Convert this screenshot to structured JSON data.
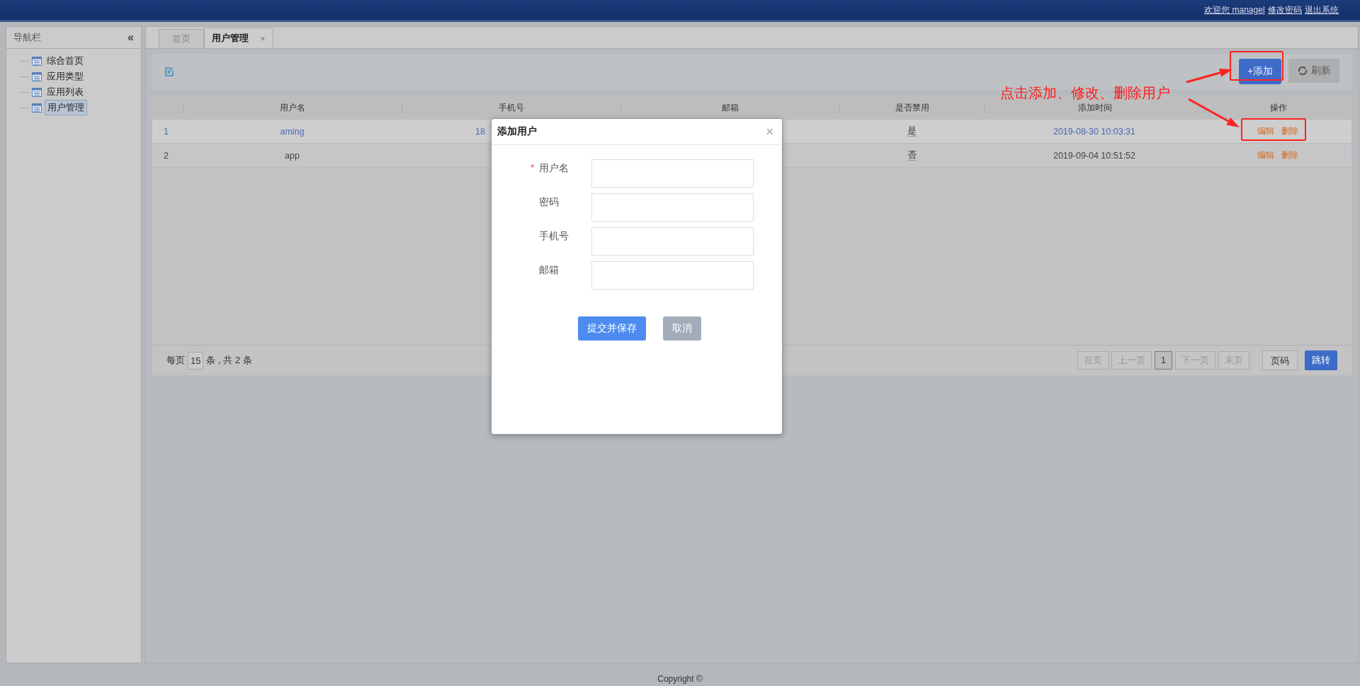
{
  "header": {
    "links": [
      {
        "text": "欢迎您 manage|"
      },
      {
        "text": "修改密码"
      },
      {
        "text": "退出系统"
      }
    ]
  },
  "sidebar": {
    "title": "导航栏",
    "collapse": "«",
    "items": [
      {
        "label": "综合首页",
        "selected": false
      },
      {
        "label": "应用类型",
        "selected": false
      },
      {
        "label": "应用列表",
        "selected": false
      },
      {
        "label": "用户管理",
        "selected": true
      }
    ]
  },
  "tabs": [
    {
      "label": "首页",
      "selected": false
    },
    {
      "label": "用户管理",
      "selected": true,
      "close": "×"
    }
  ],
  "toolbar": {
    "add": "+添加",
    "refresh": "刷新"
  },
  "table": {
    "columns": [
      "用户名",
      "手机号",
      "邮箱",
      "是否禁用",
      "添加时间",
      "操作"
    ],
    "rows": [
      {
        "index": "1",
        "username": "aming",
        "phone": "18",
        "disabled": "是",
        "added": "2019-08-30 10:03:31",
        "actions": [
          "编辑",
          "删除"
        ],
        "selected": true
      },
      {
        "index": "2",
        "username": "app",
        "disabled": "否",
        "added": "2019-09-04 10:51:52",
        "actions": [
          "编辑",
          "删除"
        ],
        "selected": false
      }
    ]
  },
  "pager": {
    "per_page_label": "每页",
    "per_page": "15",
    "count_text": "条 , 共 2 条",
    "pages": [
      {
        "label": "首页",
        "selected": false
      },
      {
        "label": "上一页",
        "selected": false
      },
      {
        "label": "1",
        "selected": true
      },
      {
        "label": "下一页",
        "selected": false
      },
      {
        "label": "末页",
        "selected": false
      }
    ],
    "page_placeholder": "页码",
    "go": "跳转"
  },
  "modal": {
    "title": "添加用户",
    "close": "×",
    "required_mark": "*",
    "fields": [
      {
        "label": "用户名",
        "required": true
      },
      {
        "label": "密码",
        "required": false
      },
      {
        "label": "手机号",
        "required": false
      },
      {
        "label": "邮箱",
        "required": false
      }
    ],
    "submit": "提交并保存",
    "cancel": "取消"
  },
  "annotation": {
    "text": "点击添加、修改、删除用户"
  },
  "footer": {
    "text": "Copyright ©"
  }
}
